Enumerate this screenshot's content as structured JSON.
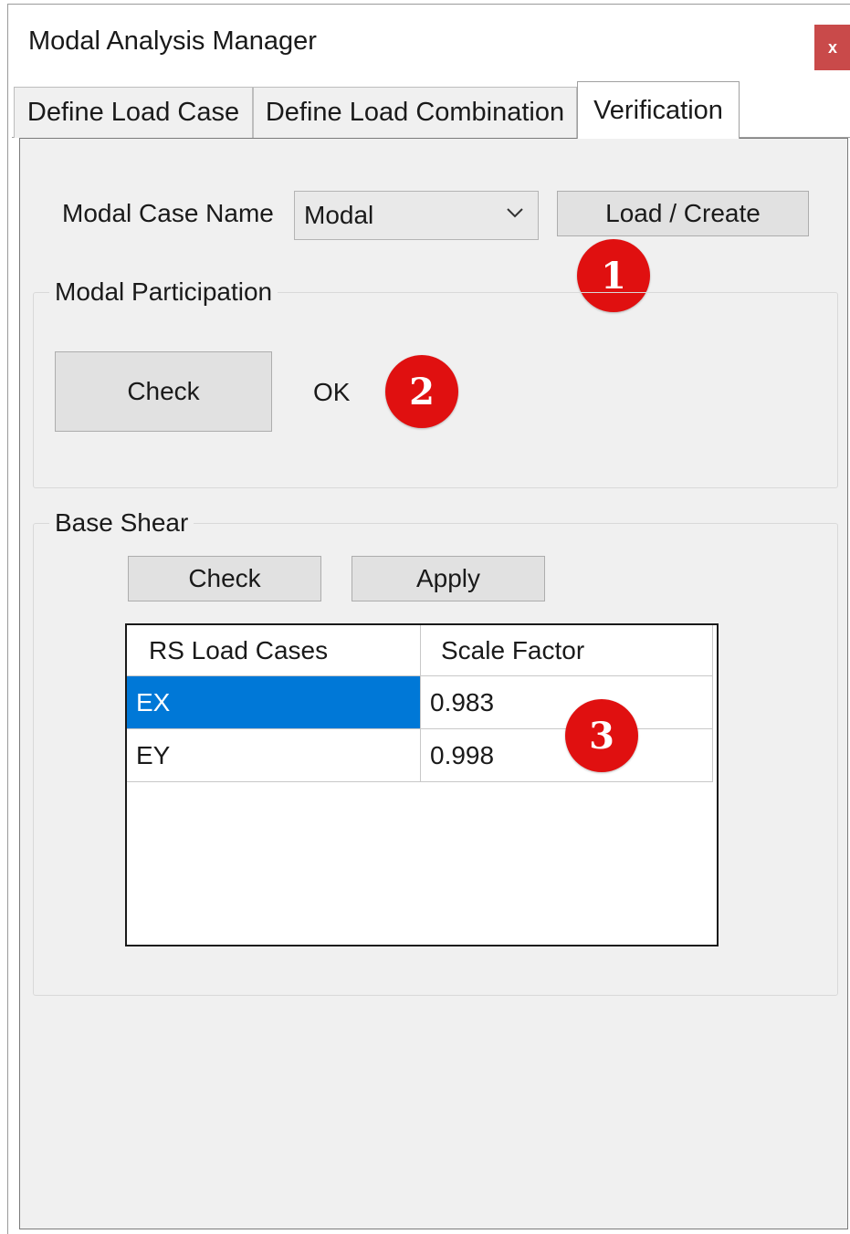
{
  "window": {
    "title": "Modal Analysis Manager",
    "close_label": "x"
  },
  "tabs": [
    {
      "label": "Define Load Case"
    },
    {
      "label": "Define Load Combination"
    },
    {
      "label": "Verification",
      "active": true
    }
  ],
  "modal_case": {
    "label": "Modal Case Name",
    "selected": "Modal",
    "load_create_label": "Load / Create"
  },
  "modal_participation": {
    "title": "Modal Participation",
    "check_label": "Check",
    "status": "OK"
  },
  "base_shear": {
    "title": "Base Shear",
    "check_label": "Check",
    "apply_label": "Apply",
    "columns": [
      "RS Load Cases",
      "Scale Factor"
    ],
    "rows": [
      {
        "load_case": "EX",
        "scale_factor": "0.983",
        "selected": true
      },
      {
        "load_case": "EY",
        "scale_factor": "0.998",
        "selected": false
      }
    ]
  },
  "annotations": [
    {
      "number": "1"
    },
    {
      "number": "2"
    },
    {
      "number": "3"
    }
  ],
  "colors": {
    "selection": "#0078d7",
    "badge": "#e01010",
    "close_button": "#c94a4a",
    "panel": "#f0f0f0"
  },
  "icons": {
    "dropdown": "chevron-down-icon"
  }
}
